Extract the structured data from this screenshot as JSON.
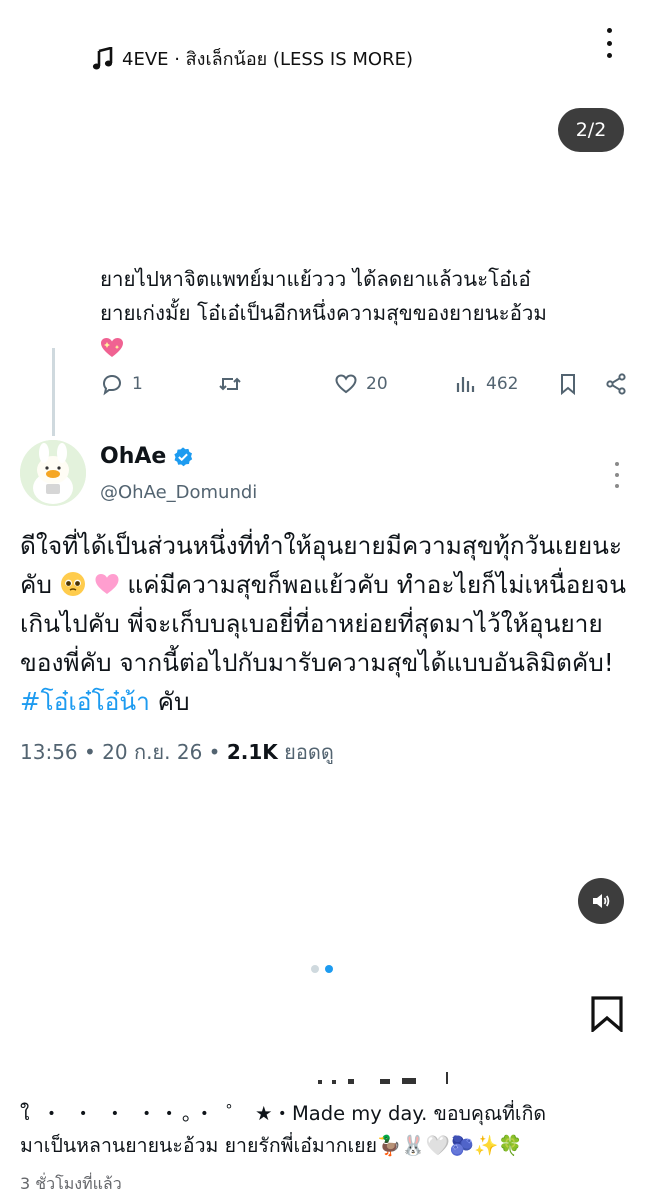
{
  "music": {
    "icon": "music-note-icon",
    "label": "4EVE · สิงเล็กน้อย (LESS IS MORE)"
  },
  "media_counter": "2/2",
  "reply": {
    "text_line1": "ยายไปหาจิตแพทย์มาแย้ววว ได้ลดยาแล้วนะโอ๋เอ๋",
    "text_line2": "ยายเก่งมั้ย โอ๋เอ๋เป็นอีกหนึ่งความสุขของยายนะอ้วม",
    "emoji": "sparkling-heart",
    "replies": "1",
    "likes": "20",
    "views": "462"
  },
  "tweet": {
    "display_name": "OhAe",
    "handle": "@OhAe_Domundi",
    "text_part1": "ดีใจที่ได้เป็นส่วนหนึ่งที่ทำให้อุนยายมีความสุขทุ้กวันเยยนะคับ",
    "text_part2": "แค่มีความสุขก็พอแย้วคับ ทำอะไยก็ไม่เหนื่อยจนเกินไปคับ พี่จะเก็บบลุเบอยี่ที่อาหย่อยที่สุดมาไว้ให้อุนยายของพี่คับ จากนี้ต่อไปกับมารับความสุขได้แบบอันลิมิตคับ!",
    "hashtag": "#โอ๋เอ๋โอ๋น้า",
    "text_part3": "คับ",
    "time": "13:56",
    "date": "20 ก.ย. 26",
    "views_count": "2.1K",
    "views_label": "ยอดดู"
  },
  "carousel": {
    "total": 2,
    "active": 2
  },
  "caption": {
    "prefix": "ใ  ・ ・ ・ ・・。・ ゜",
    "text_line1": "★・Made my day. ขอบคุณที่เกิด",
    "text_line2": "มาเป็นหลานยายนะอ้วม ยายรักพี่เอ๋มากเยย🦆🐰🤍🫐✨🍀",
    "time_ago": "3 ชั่วโมงที่แล้ว"
  },
  "colors": {
    "link": "#1d9bf0",
    "secondary": "#536471",
    "pill": "#3d3d3d",
    "verified": "#1d9bf0"
  }
}
